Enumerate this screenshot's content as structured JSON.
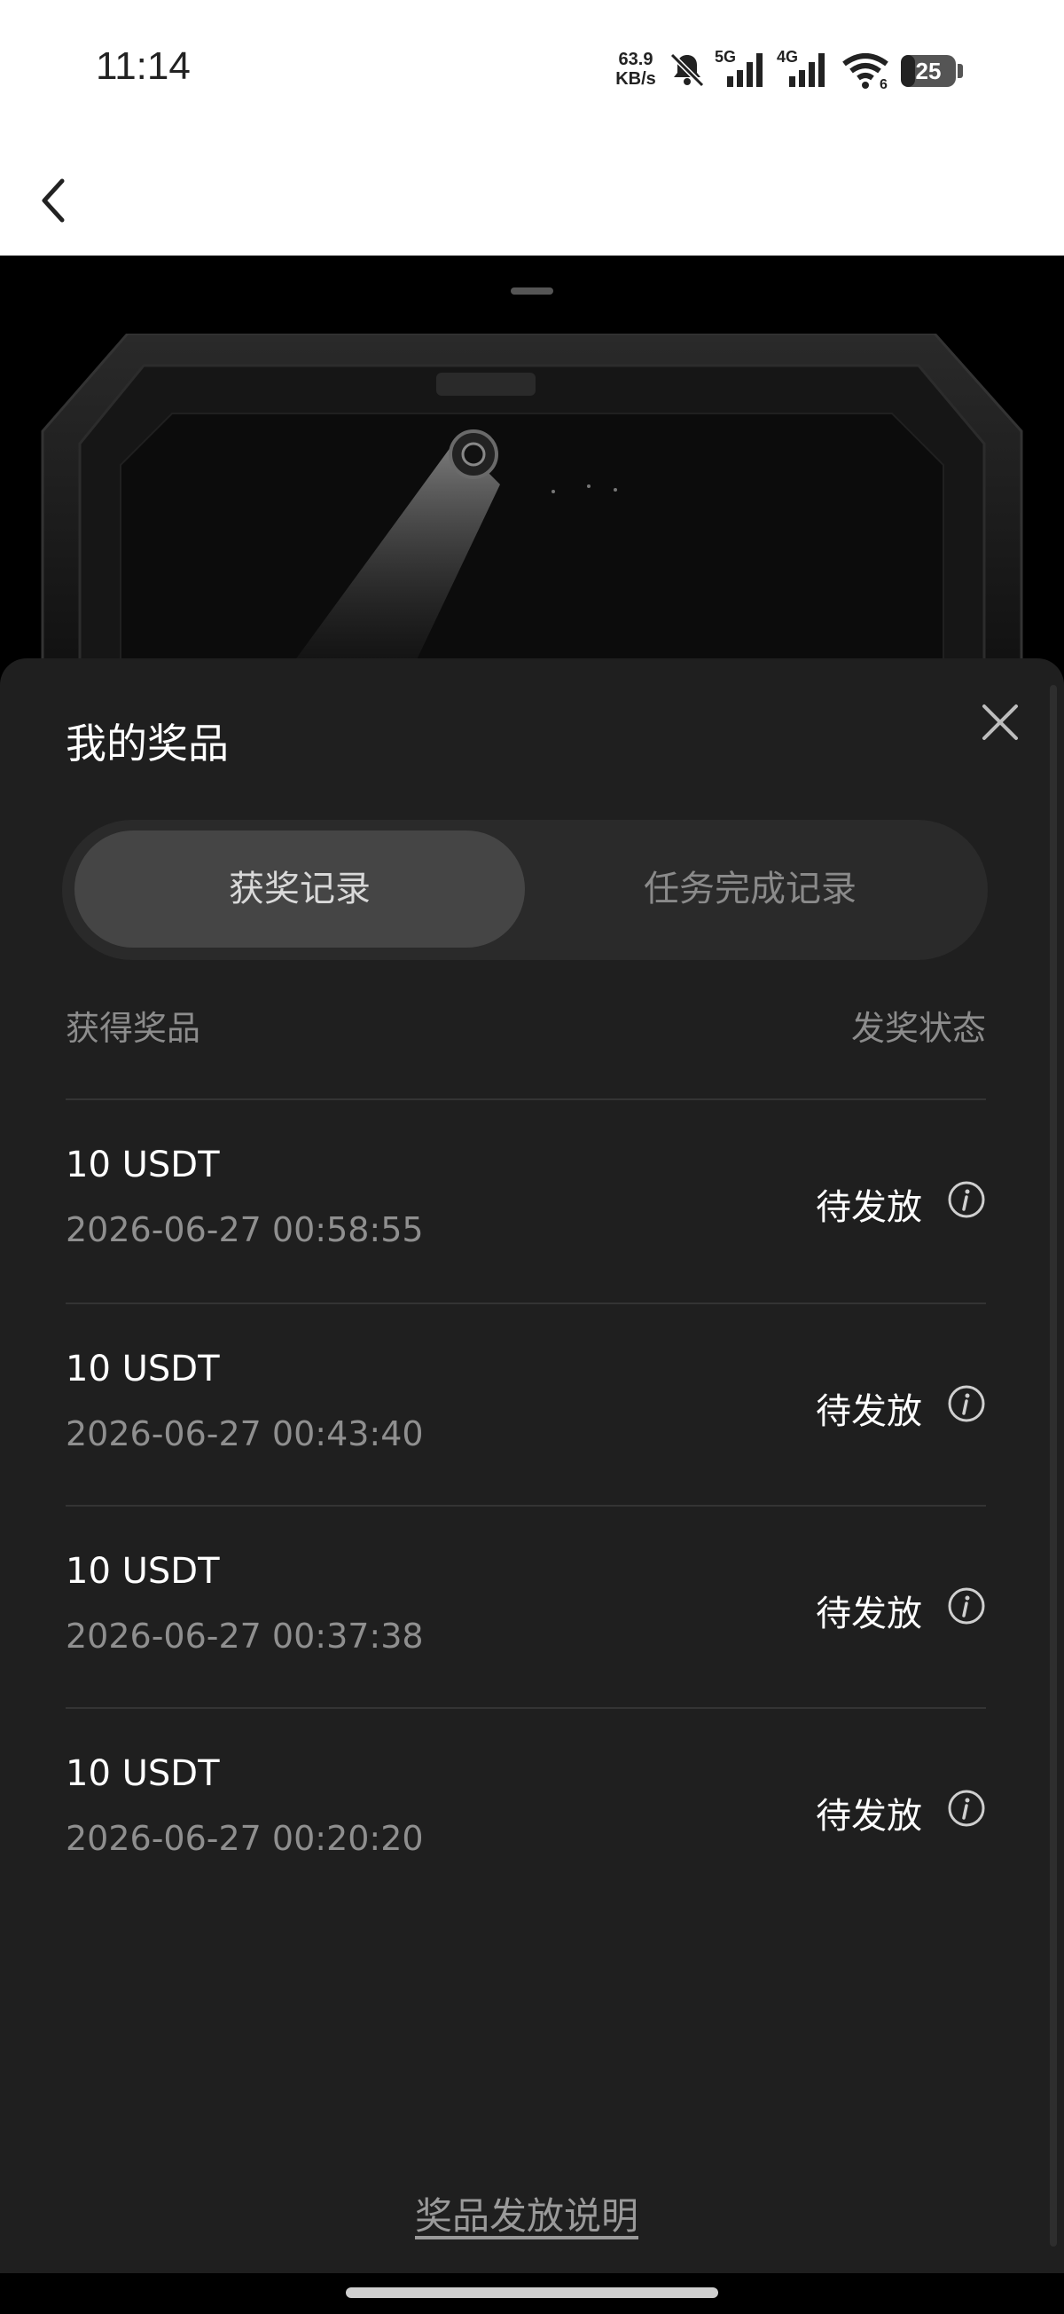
{
  "status_bar": {
    "time": "11:14",
    "speed_value": "63.9",
    "speed_unit": "KB/s",
    "network_5g": "5G",
    "network_4g": "4G",
    "wifi_label": "6",
    "battery": "25",
    "icons": [
      "mute-bell-icon",
      "signal-5g-icon",
      "signal-4g-icon",
      "wifi-icon",
      "battery-icon"
    ]
  },
  "header": {
    "back_icon": "chevron-left-icon"
  },
  "sheet": {
    "title": "我的奖品",
    "close_icon": "close-icon",
    "tabs": [
      {
        "label": "获奖记录",
        "active": true
      },
      {
        "label": "任务完成记录",
        "active": false
      }
    ],
    "columns": {
      "left": "获得奖品",
      "right": "发奖状态"
    },
    "records": [
      {
        "prize": "10 USDT",
        "time": "2026-06-27 00:58:55",
        "status": "待发放"
      },
      {
        "prize": "10 USDT",
        "time": "2026-06-27 00:43:40",
        "status": "待发放"
      },
      {
        "prize": "10 USDT",
        "time": "2026-06-27 00:37:38",
        "status": "待发放"
      },
      {
        "prize": "10 USDT",
        "time": "2026-06-27 00:20:20",
        "status": "待发放"
      }
    ],
    "explain_link": "奖品发放说明"
  },
  "colors": {
    "sheet_bg": "#1f1f1f",
    "tab_active_bg": "#454545",
    "tab_track_bg": "#2a2a2a",
    "muted_text": "#8c8c8c"
  }
}
